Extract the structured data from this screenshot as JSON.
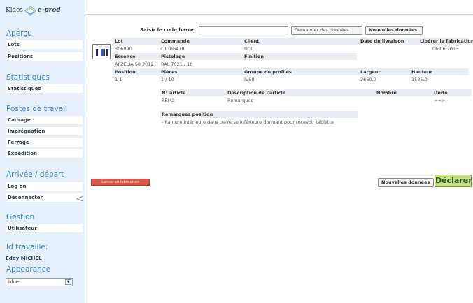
{
  "logo": {
    "brand": "Klaes",
    "product": "e-prod"
  },
  "sidebar": {
    "apercu": {
      "title": "Aperçu",
      "items": [
        {
          "label": "Lots"
        },
        {
          "label": "Positions"
        }
      ]
    },
    "statistiques": {
      "title": "Statistiques",
      "items": [
        {
          "label": "Statistiques"
        }
      ]
    },
    "postes": {
      "title": "Postes de travail",
      "items": [
        {
          "label": "Cadrage"
        },
        {
          "label": "Imprégnation"
        },
        {
          "label": "Ferrage"
        },
        {
          "label": "Expédition"
        }
      ]
    },
    "arrivee": {
      "title": "Arrivée / départ",
      "items": [
        {
          "label": "Log on"
        },
        {
          "label": "Déconnecter"
        }
      ]
    },
    "gestion": {
      "title": "Gestion",
      "items": [
        {
          "label": "Utilisateur"
        }
      ]
    },
    "travaille": {
      "title": "Id travaille:",
      "name": "Eddy MICHEL"
    },
    "appearance": {
      "title": "Appearance",
      "selected": "blue"
    },
    "collapse_glyph": "<"
  },
  "barcode": {
    "label": "Saisir le code barre:",
    "value": ""
  },
  "buttons": {
    "request": "Demander des données",
    "new": "Nouvelles données",
    "new2": "Nouvelles données",
    "declare": "Déclarer",
    "red": "Lancer en fabrication"
  },
  "lot": {
    "headers": {
      "lot": "Lot",
      "commande": "Commande",
      "client": "Client",
      "livraison": "Date de livraison",
      "liberer": "Libérer la fabrication"
    },
    "values": {
      "lot": "306090",
      "commande": "C1306478",
      "client": "UCL",
      "livraison": "",
      "liberer": "06.06.2013"
    },
    "headers2": {
      "essence": "Essence",
      "pistolage": "Pistolage",
      "finition": "Finition"
    },
    "values2": {
      "essence": "AFZELIA 58 2012",
      "pistolage": "RAL 7021 / 10",
      "finition": ""
    },
    "headers3": {
      "position": "Position",
      "pieces": "Pièces",
      "groupe": "Groupe de profilés",
      "largeur": "Largeur",
      "hauteur": "Hauteur"
    },
    "values3": {
      "position": "1-1",
      "pieces": "1 / 10",
      "groupe": "IV58",
      "largeur": "2660.0",
      "hauteur": "1585.0"
    }
  },
  "articles": {
    "headers": {
      "num": "N° article",
      "desc": "Description de l'article",
      "nombre": "Nombre",
      "unite": "Unité"
    },
    "row": {
      "num": "REM2",
      "desc": "Remarques",
      "nombre": "",
      "unite": "==>"
    }
  },
  "remarques": {
    "title": "Remarques position",
    "text": "- Rainure intérieure dans traverse inférieure dormant pour recevoir tablette"
  }
}
